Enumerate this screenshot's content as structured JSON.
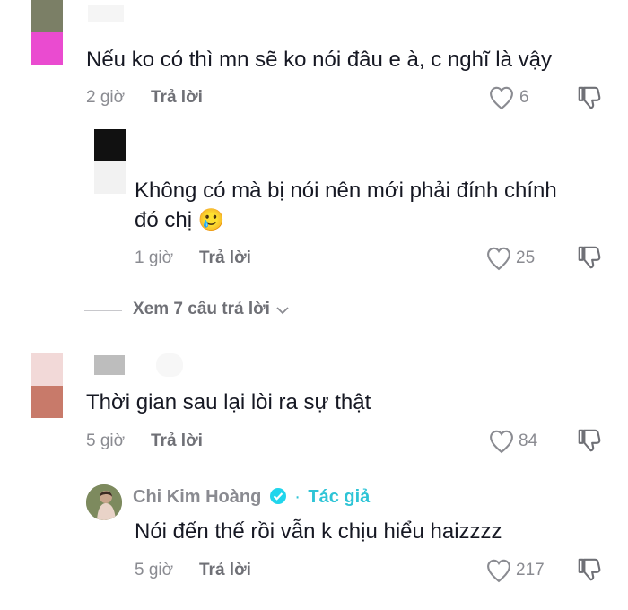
{
  "comments": [
    {
      "text": "Nếu ko có thì mn sẽ ko nói đâu e à, c nghĩ là vậy",
      "time": "2 giờ",
      "reply": "Trả lời",
      "likes": "6",
      "avatar_colors": [
        "#7b7f66",
        "#ea4bd0"
      ]
    },
    {
      "text_line1": "Không có mà bị nói nên mới phải đính chính",
      "text_line2": "đó chị",
      "emoji": "🥲",
      "time": "1 giờ",
      "reply": "Trả lời",
      "likes": "25",
      "avatar_colors": [
        "#111111",
        "#f2f2f2"
      ]
    },
    {
      "text": "Thời gian sau lại lòi ra sự thật",
      "time": "5 giờ",
      "reply": "Trả lời",
      "likes": "84",
      "avatar_colors": [
        "#f2d9d8",
        "#c87a6a"
      ]
    },
    {
      "author": "Chi Kim Hoàng",
      "author_badge": "Tác giả",
      "text": "Nói đến thế rồi vẫn k chịu hiểu haizzzz",
      "time": "5 giờ",
      "reply": "Trả lời",
      "likes": "217"
    }
  ],
  "view_replies": {
    "label": "Xem 7 câu trả lời"
  },
  "colors": {
    "verified": "#20d5ec",
    "author_badge": "#2ec4d6",
    "text": "#161823",
    "meta": "#8a8b91"
  },
  "icons": [
    "heart-outline-icon",
    "thumbs-down-icon",
    "chevron-down-icon",
    "verified-badge-icon"
  ]
}
